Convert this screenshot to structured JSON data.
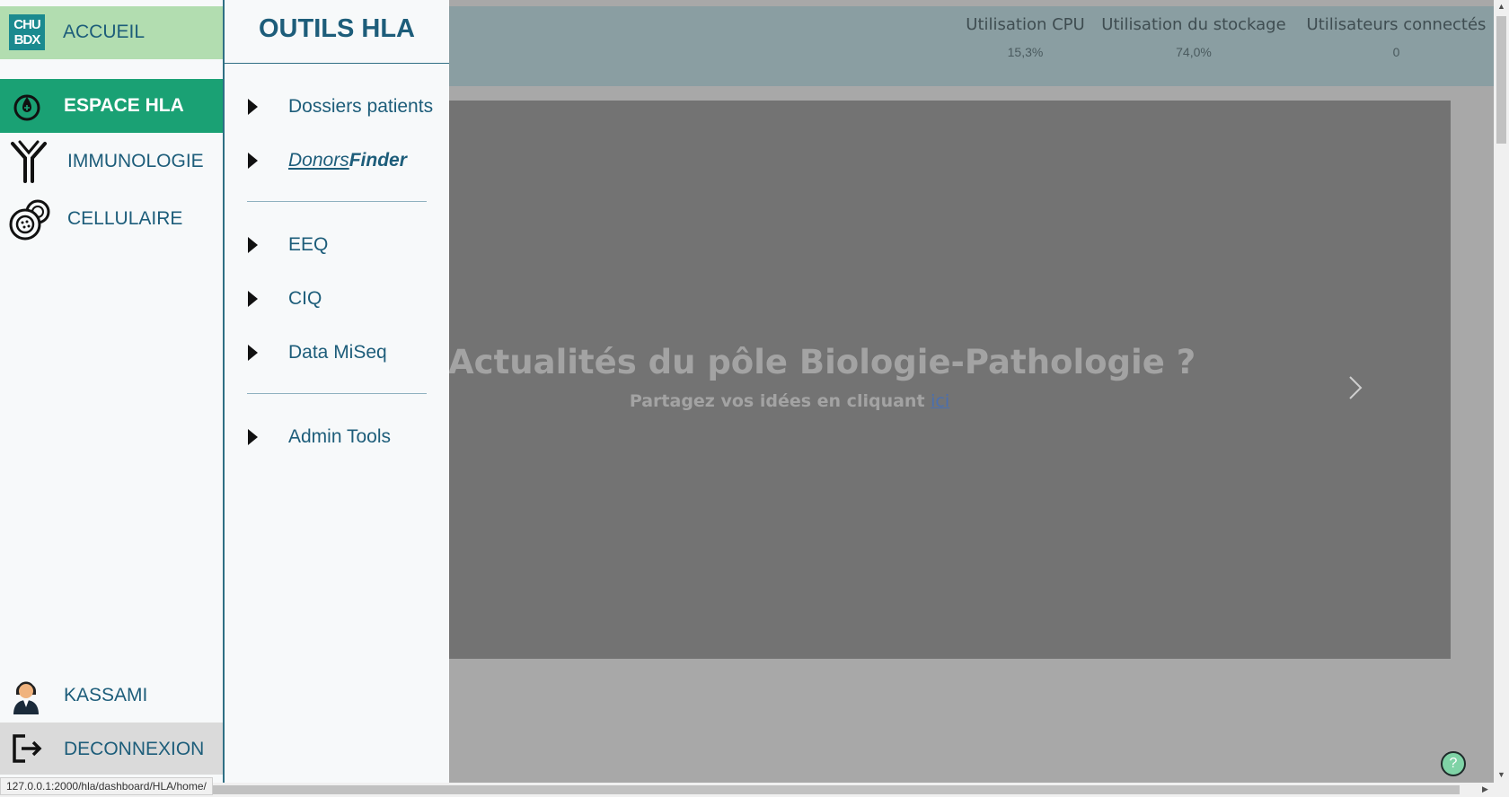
{
  "sidebar": {
    "logo_text": "CHU BDX",
    "accueil": "ACCUEIL",
    "espace_hla": "ESPACE HLA",
    "immunologie": "IMMUNOLOGIE",
    "cellulaire": "CELLULAIRE",
    "user": "KASSAMI",
    "logout": "DECONNEXION"
  },
  "tools": {
    "title": "OUTILS HLA",
    "items": [
      {
        "label": "Dossiers patients"
      },
      {
        "label_part1": "Donors",
        "label_part2": "Finder"
      },
      {
        "label": "EEQ"
      },
      {
        "label": "CIQ"
      },
      {
        "label": "Data MiSeq"
      },
      {
        "label": "Admin Tools"
      }
    ]
  },
  "stats": [
    {
      "label": "Utilisation CPU",
      "value": "15,3%"
    },
    {
      "label": "Utilisation du stockage",
      "value": "74,0%"
    },
    {
      "label": "Utilisateurs connectés",
      "value": "0"
    }
  ],
  "carousel": {
    "title": "Actualités du pôle Biologie-Pathologie ?",
    "subtitle": "Partagez vos idées en cliquant",
    "link": "ici"
  },
  "help": "?",
  "status_url": "127.0.0.1:2000/hla/dashboard/HLA/home/",
  "colors": {
    "accent_green": "#1aa174",
    "accueil_bg": "#b2ddb0",
    "text_blue": "#1d5d7a",
    "header_bg": "#8a9ea2"
  }
}
